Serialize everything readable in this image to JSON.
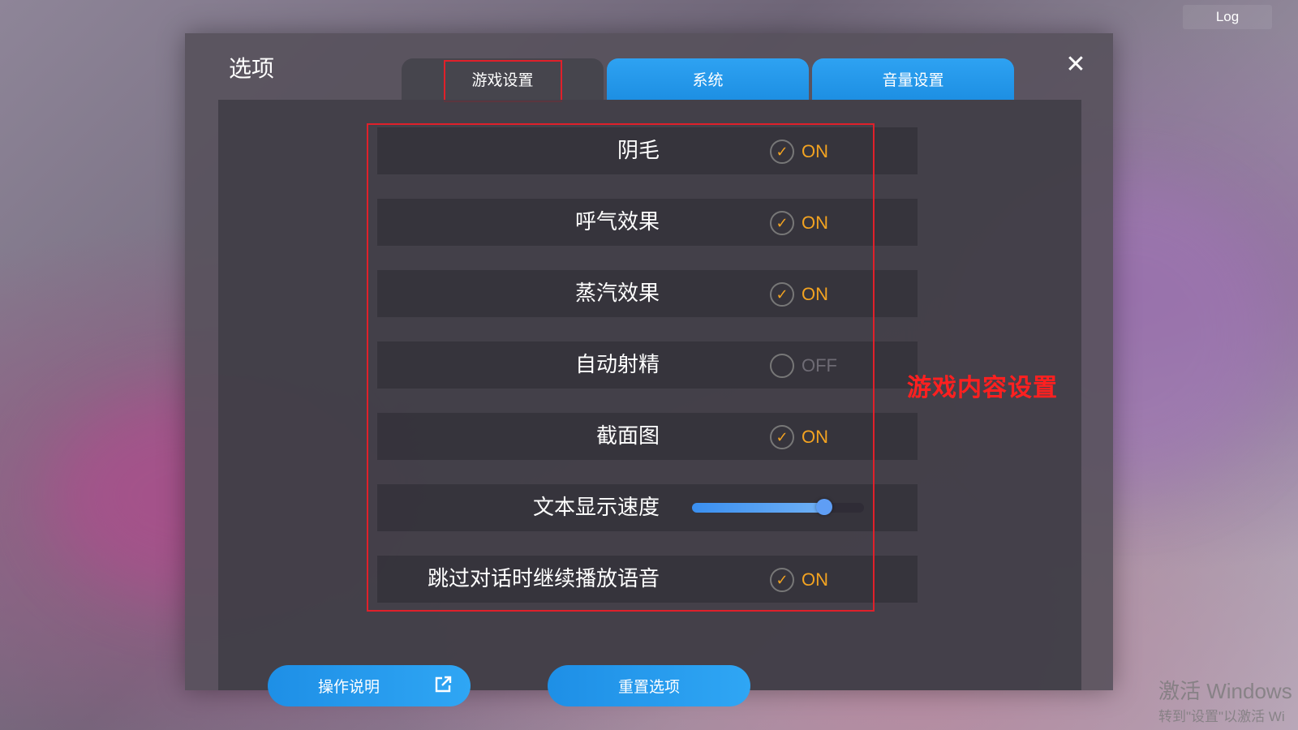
{
  "log_button": "Log",
  "dialog": {
    "title": "选项",
    "tabs": [
      {
        "label": "游戏设置",
        "active": true
      },
      {
        "label": "系统",
        "active": false
      },
      {
        "label": "音量设置",
        "active": false
      }
    ],
    "settings": [
      {
        "label": "阴毛",
        "type": "toggle",
        "state": "ON"
      },
      {
        "label": "呼气效果",
        "type": "toggle",
        "state": "ON"
      },
      {
        "label": "蒸汽效果",
        "type": "toggle",
        "state": "ON"
      },
      {
        "label": "自动射精",
        "type": "toggle",
        "state": "OFF"
      },
      {
        "label": "截面图",
        "type": "toggle",
        "state": "ON"
      },
      {
        "label": "文本显示速度",
        "type": "slider",
        "value": 0.77
      },
      {
        "label": "跳过对话时继续播放语音",
        "type": "toggle",
        "state": "ON"
      }
    ],
    "buttons": {
      "manual": "操作说明",
      "reset": "重置选项"
    }
  },
  "annotation": "游戏内容设置",
  "watermark": {
    "line1": "激活 Windows",
    "line2": "转到\"设置\"以激活 Wi"
  },
  "colors": {
    "accent_blue": "#1e8fe6",
    "on_orange": "#f3a321",
    "highlight_red": "#e0202a"
  }
}
